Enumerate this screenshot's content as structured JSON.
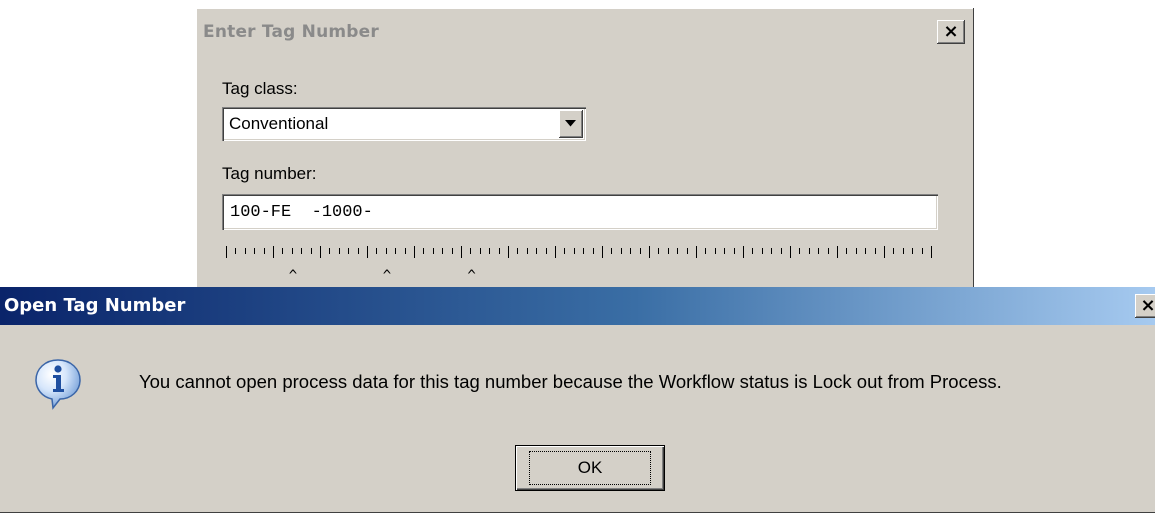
{
  "enter_dialog": {
    "title": "Enter Tag Number",
    "close_glyph": "×",
    "tag_class_label": "Tag class:",
    "tag_class_value": "Conventional",
    "tag_number_label": "Tag number:",
    "tag_number_value": "100-FE  -1000-",
    "ruler_marks_per_group": 5,
    "ruler_groups": 15,
    "caret_glyph": "^",
    "caret_columns": [
      7,
      17,
      26
    ]
  },
  "open_dialog": {
    "title": "Open Tag Number",
    "close_glyph": "×",
    "icon": "info-icon",
    "message": "You cannot open process data for this tag number because the Workflow status is Lock out from Process.",
    "ok_label": "OK"
  },
  "colors": {
    "dialog_face": "#d4d0c8",
    "active_title_start": "#0a246a",
    "active_title_end": "#a6caf0",
    "inactive_title_text": "#8a8a8a"
  }
}
